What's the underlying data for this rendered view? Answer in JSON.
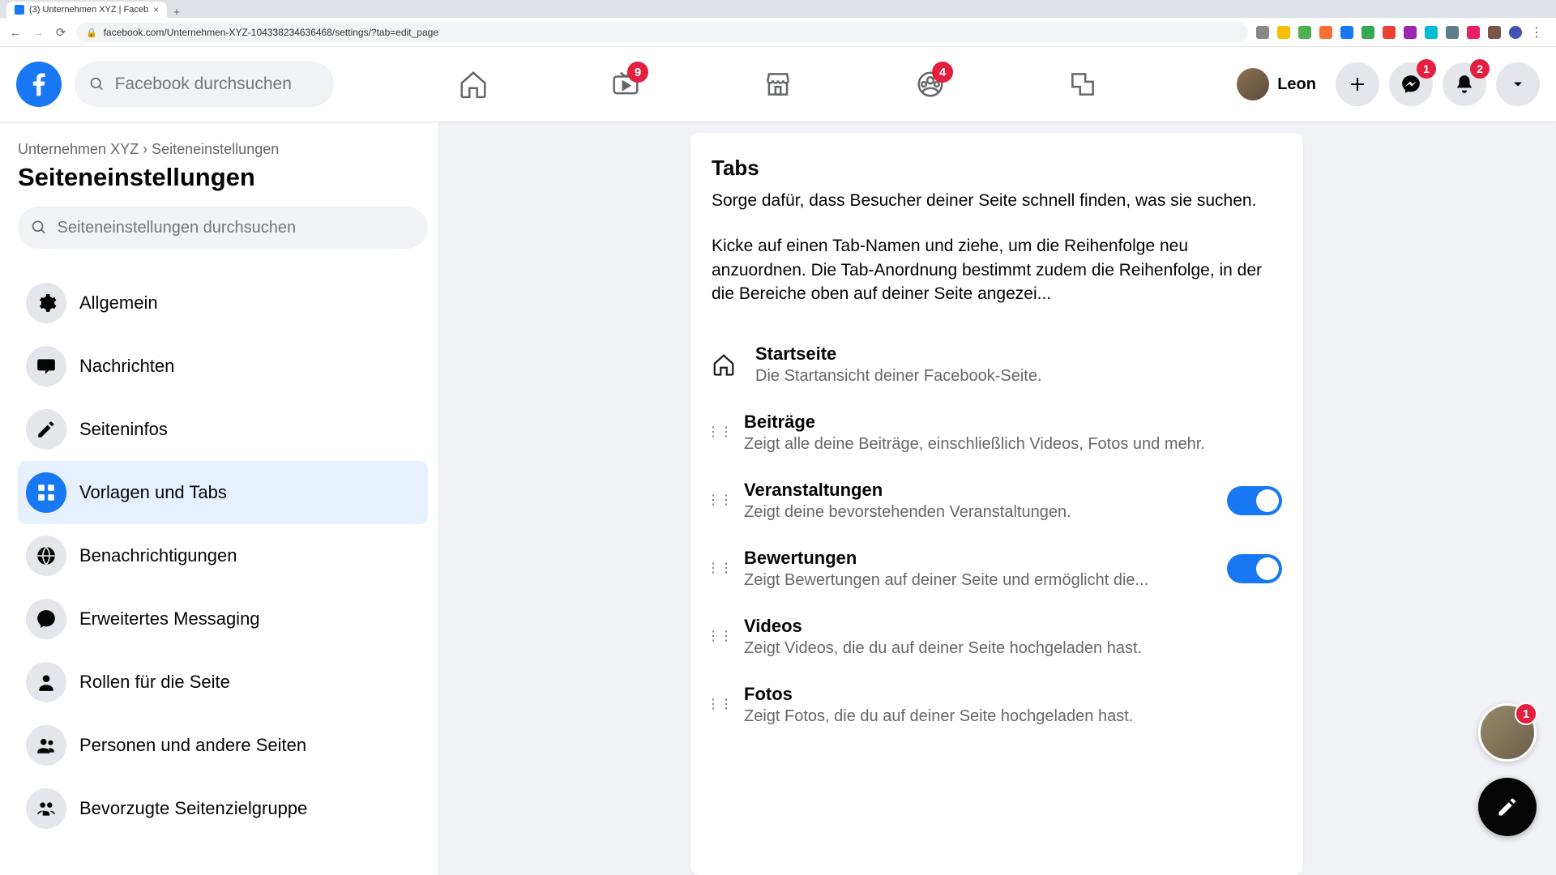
{
  "browser": {
    "tab_title": "(3) Unternehmen XYZ | Faceb",
    "url": "facebook.com/Unternehmen-XYZ-104338234636468/settings/?tab=edit_page"
  },
  "header": {
    "search_placeholder": "Facebook durchsuchen",
    "watch_badge": "9",
    "groups_badge": "4",
    "profile_name": "Leon",
    "messenger_badge": "1",
    "notifications_badge": "2"
  },
  "sidebar": {
    "breadcrumb_page": "Unternehmen XYZ",
    "breadcrumb_sep": "›",
    "breadcrumb_current": "Seiteneinstellungen",
    "title": "Seiteneinstellungen",
    "search_placeholder": "Seiteneinstellungen durchsuchen",
    "items": [
      {
        "label": "Allgemein",
        "icon": "gear"
      },
      {
        "label": "Nachrichten",
        "icon": "chat"
      },
      {
        "label": "Seiteninfos",
        "icon": "pencil"
      },
      {
        "label": "Vorlagen und Tabs",
        "icon": "grid",
        "active": true
      },
      {
        "label": "Benachrichtigungen",
        "icon": "globe"
      },
      {
        "label": "Erweitertes Messaging",
        "icon": "messenger"
      },
      {
        "label": "Rollen für die Seite",
        "icon": "person"
      },
      {
        "label": "Personen und andere Seiten",
        "icon": "people"
      },
      {
        "label": "Bevorzugte Seitenzielgruppe",
        "icon": "audience"
      }
    ]
  },
  "main": {
    "heading": "Tabs",
    "desc1": "Sorge dafür, dass Besucher deiner Seite schnell finden, was sie suchen.",
    "desc2": "Kicke auf einen Tab-Namen und ziehe, um die Reihenfolge neu anzuordnen. Die Tab-Anordnung bestimmt zudem die Reihenfolge, in der die Bereiche oben auf deiner Seite angezei...",
    "tabs": [
      {
        "title": "Startseite",
        "sub": "Die Startansicht deiner Facebook-Seite.",
        "fixed": true
      },
      {
        "title": "Beiträge",
        "sub": "Zeigt alle deine Beiträge, einschließlich Videos, Fotos und mehr."
      },
      {
        "title": "Veranstaltungen",
        "sub": "Zeigt deine bevorstehenden Veranstaltungen.",
        "toggle": true
      },
      {
        "title": "Bewertungen",
        "sub": "Zeigt Bewertungen auf deiner Seite und ermöglicht die...",
        "toggle": true
      },
      {
        "title": "Videos",
        "sub": "Zeigt Videos, die du auf deiner Seite hochgeladen hast."
      },
      {
        "title": "Fotos",
        "sub": "Zeigt Fotos, die du auf deiner Seite hochgeladen hast."
      }
    ]
  },
  "floating": {
    "chat_badge": "1"
  }
}
